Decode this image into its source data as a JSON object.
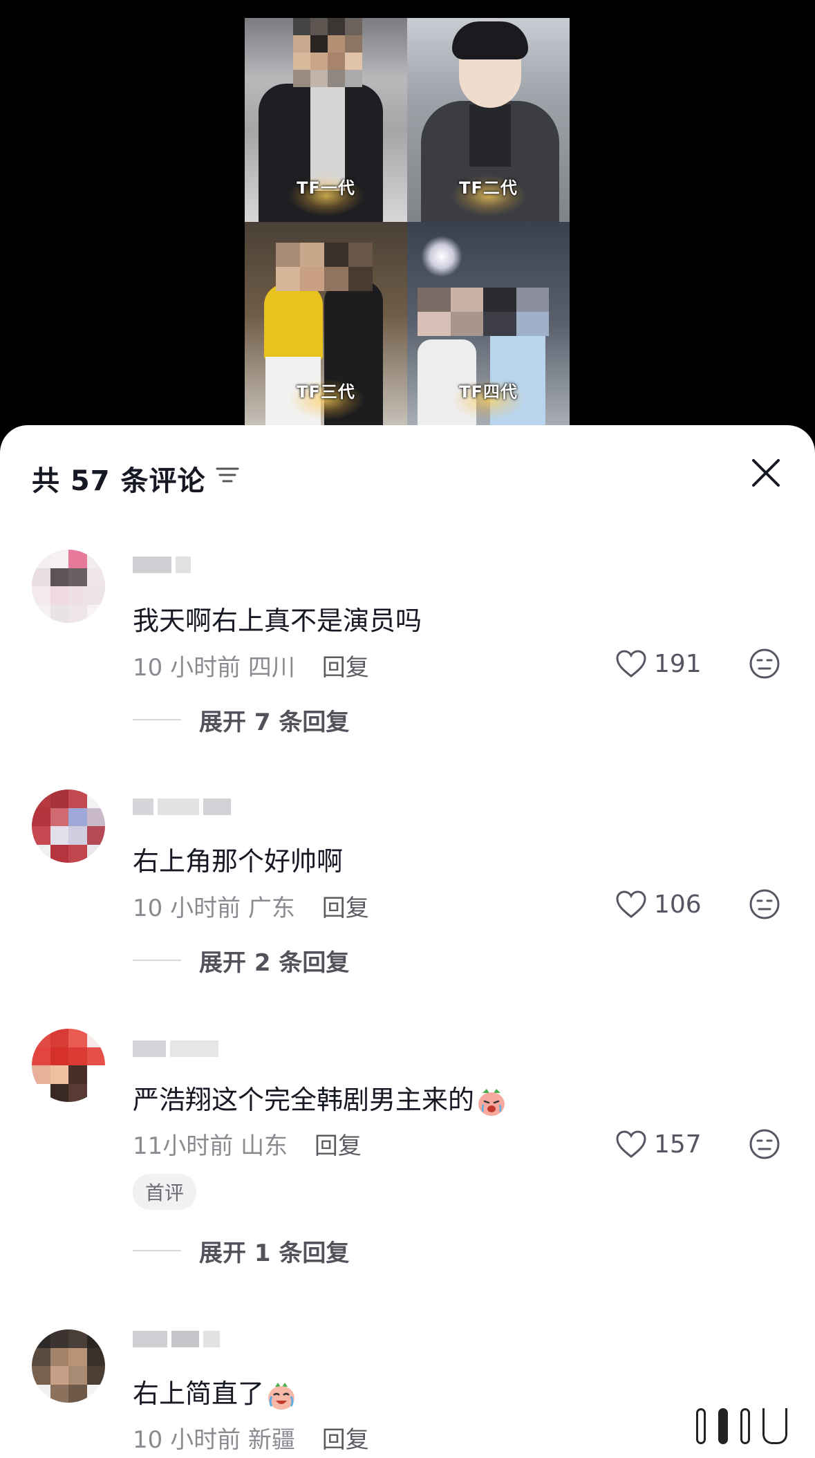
{
  "video": {
    "tiles": [
      {
        "label": "TF一代"
      },
      {
        "label": "TF二代"
      },
      {
        "label": "TF三代"
      },
      {
        "label": "TF四代"
      }
    ]
  },
  "sheet": {
    "title": "共 57 条评论",
    "sort_icon": "sort-filter-icon",
    "close_icon": "close-icon"
  },
  "comments": [
    {
      "text": "我天啊右上真不是演员吗",
      "time": "10 小时前",
      "location": "四川",
      "reply_label": "回复",
      "likes": "191",
      "expand": "展开 7 条回复",
      "avatar_color": "#e9d9dc"
    },
    {
      "text": "右上角那个好帅啊",
      "time": "10 小时前",
      "location": "广东",
      "reply_label": "回复",
      "likes": "106",
      "expand": "展开 2 条回复",
      "avatar_color": "#b73a43"
    },
    {
      "text": "严浩翔这个完全韩剧男主来的",
      "time": "11小时前",
      "location": "山东",
      "reply_label": "回复",
      "likes": "157",
      "badge": "首评",
      "expand": "展开 1 条回复",
      "avatar_color": "#d8352f"
    },
    {
      "text": "右上简直了",
      "time": "10 小时前",
      "location": "新疆",
      "reply_label": "回复",
      "avatar_color": "#6a5646"
    }
  ],
  "colors": {
    "text_primary": "#161823",
    "text_secondary": "#8a8b91",
    "accent_badge_bg": "#f1f1f3"
  }
}
